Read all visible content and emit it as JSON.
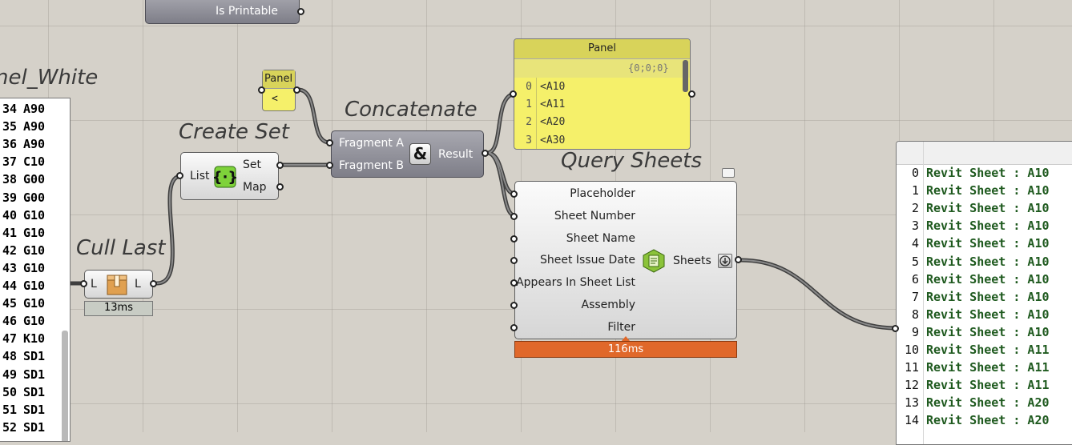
{
  "top_component": {
    "label": "Is Printable"
  },
  "left_panel": {
    "title": "nel_White",
    "rows": [
      {
        "index": "34",
        "value": "A90"
      },
      {
        "index": "35",
        "value": "A90"
      },
      {
        "index": "36",
        "value": "A90"
      },
      {
        "index": "37",
        "value": "C10"
      },
      {
        "index": "38",
        "value": "G00"
      },
      {
        "index": "39",
        "value": "G00"
      },
      {
        "index": "40",
        "value": "G10"
      },
      {
        "index": "41",
        "value": "G10"
      },
      {
        "index": "42",
        "value": "G10"
      },
      {
        "index": "43",
        "value": "G10"
      },
      {
        "index": "44",
        "value": "G10"
      },
      {
        "index": "45",
        "value": "G10"
      },
      {
        "index": "46",
        "value": "G10"
      },
      {
        "index": "47",
        "value": "K10"
      },
      {
        "index": "48",
        "value": "SD1"
      },
      {
        "index": "49",
        "value": "SD1"
      },
      {
        "index": "50",
        "value": "SD1"
      },
      {
        "index": "51",
        "value": "SD1"
      },
      {
        "index": "52",
        "value": "SD1"
      }
    ]
  },
  "cull_last": {
    "title": "Cull Last",
    "input": "L",
    "output": "L",
    "timer": "13ms",
    "icon": "box-icon"
  },
  "create_set": {
    "title": "Create Set",
    "input": "List",
    "outputs": [
      "Set",
      "Map"
    ],
    "icon": "set-braces-icon"
  },
  "small_panel": {
    "header": "Panel",
    "value": "<"
  },
  "concatenate": {
    "title": "Concatenate",
    "inputs": [
      "Fragment A",
      "Fragment B"
    ],
    "output": "Result",
    "icon_glyph": "&"
  },
  "yellow_panel": {
    "header": "Panel",
    "path": "{0;0;0}",
    "rows": [
      {
        "index": "0",
        "value": "<A10"
      },
      {
        "index": "1",
        "value": "<A11"
      },
      {
        "index": "2",
        "value": "<A20"
      },
      {
        "index": "3",
        "value": "<A30"
      }
    ]
  },
  "query_sheets": {
    "title": "Query Sheets",
    "inputs": [
      "Placeholder",
      "Sheet Number",
      "Sheet Name",
      "Sheet Issue Date",
      "Appears In Sheet List",
      "Assembly",
      "Filter"
    ],
    "output": "Sheets",
    "timer": "116ms",
    "icon": "sheet-icon",
    "menu_icon": "down-arrow-icon"
  },
  "right_panel": {
    "rows": [
      {
        "index": "0",
        "value": "Revit Sheet : A10"
      },
      {
        "index": "1",
        "value": "Revit Sheet : A10"
      },
      {
        "index": "2",
        "value": "Revit Sheet : A10"
      },
      {
        "index": "3",
        "value": "Revit Sheet : A10"
      },
      {
        "index": "4",
        "value": "Revit Sheet : A10"
      },
      {
        "index": "5",
        "value": "Revit Sheet : A10"
      },
      {
        "index": "6",
        "value": "Revit Sheet : A10"
      },
      {
        "index": "7",
        "value": "Revit Sheet : A10"
      },
      {
        "index": "8",
        "value": "Revit Sheet : A10"
      },
      {
        "index": "9",
        "value": "Revit Sheet : A10"
      },
      {
        "index": "10",
        "value": "Revit Sheet : A11"
      },
      {
        "index": "11",
        "value": "Revit Sheet : A11"
      },
      {
        "index": "12",
        "value": "Revit Sheet : A11"
      },
      {
        "index": "13",
        "value": "Revit Sheet : A20"
      },
      {
        "index": "14",
        "value": "Revit Sheet : A20"
      }
    ]
  },
  "colors": {
    "canvas": "#d5d1c9",
    "panel_yellow": "#f5f06a",
    "timer_orange": "#e0682a",
    "timer_gray": "#c8ccc4",
    "right_text_green": "#1f5a1f",
    "wire": "#4a4a4a"
  }
}
